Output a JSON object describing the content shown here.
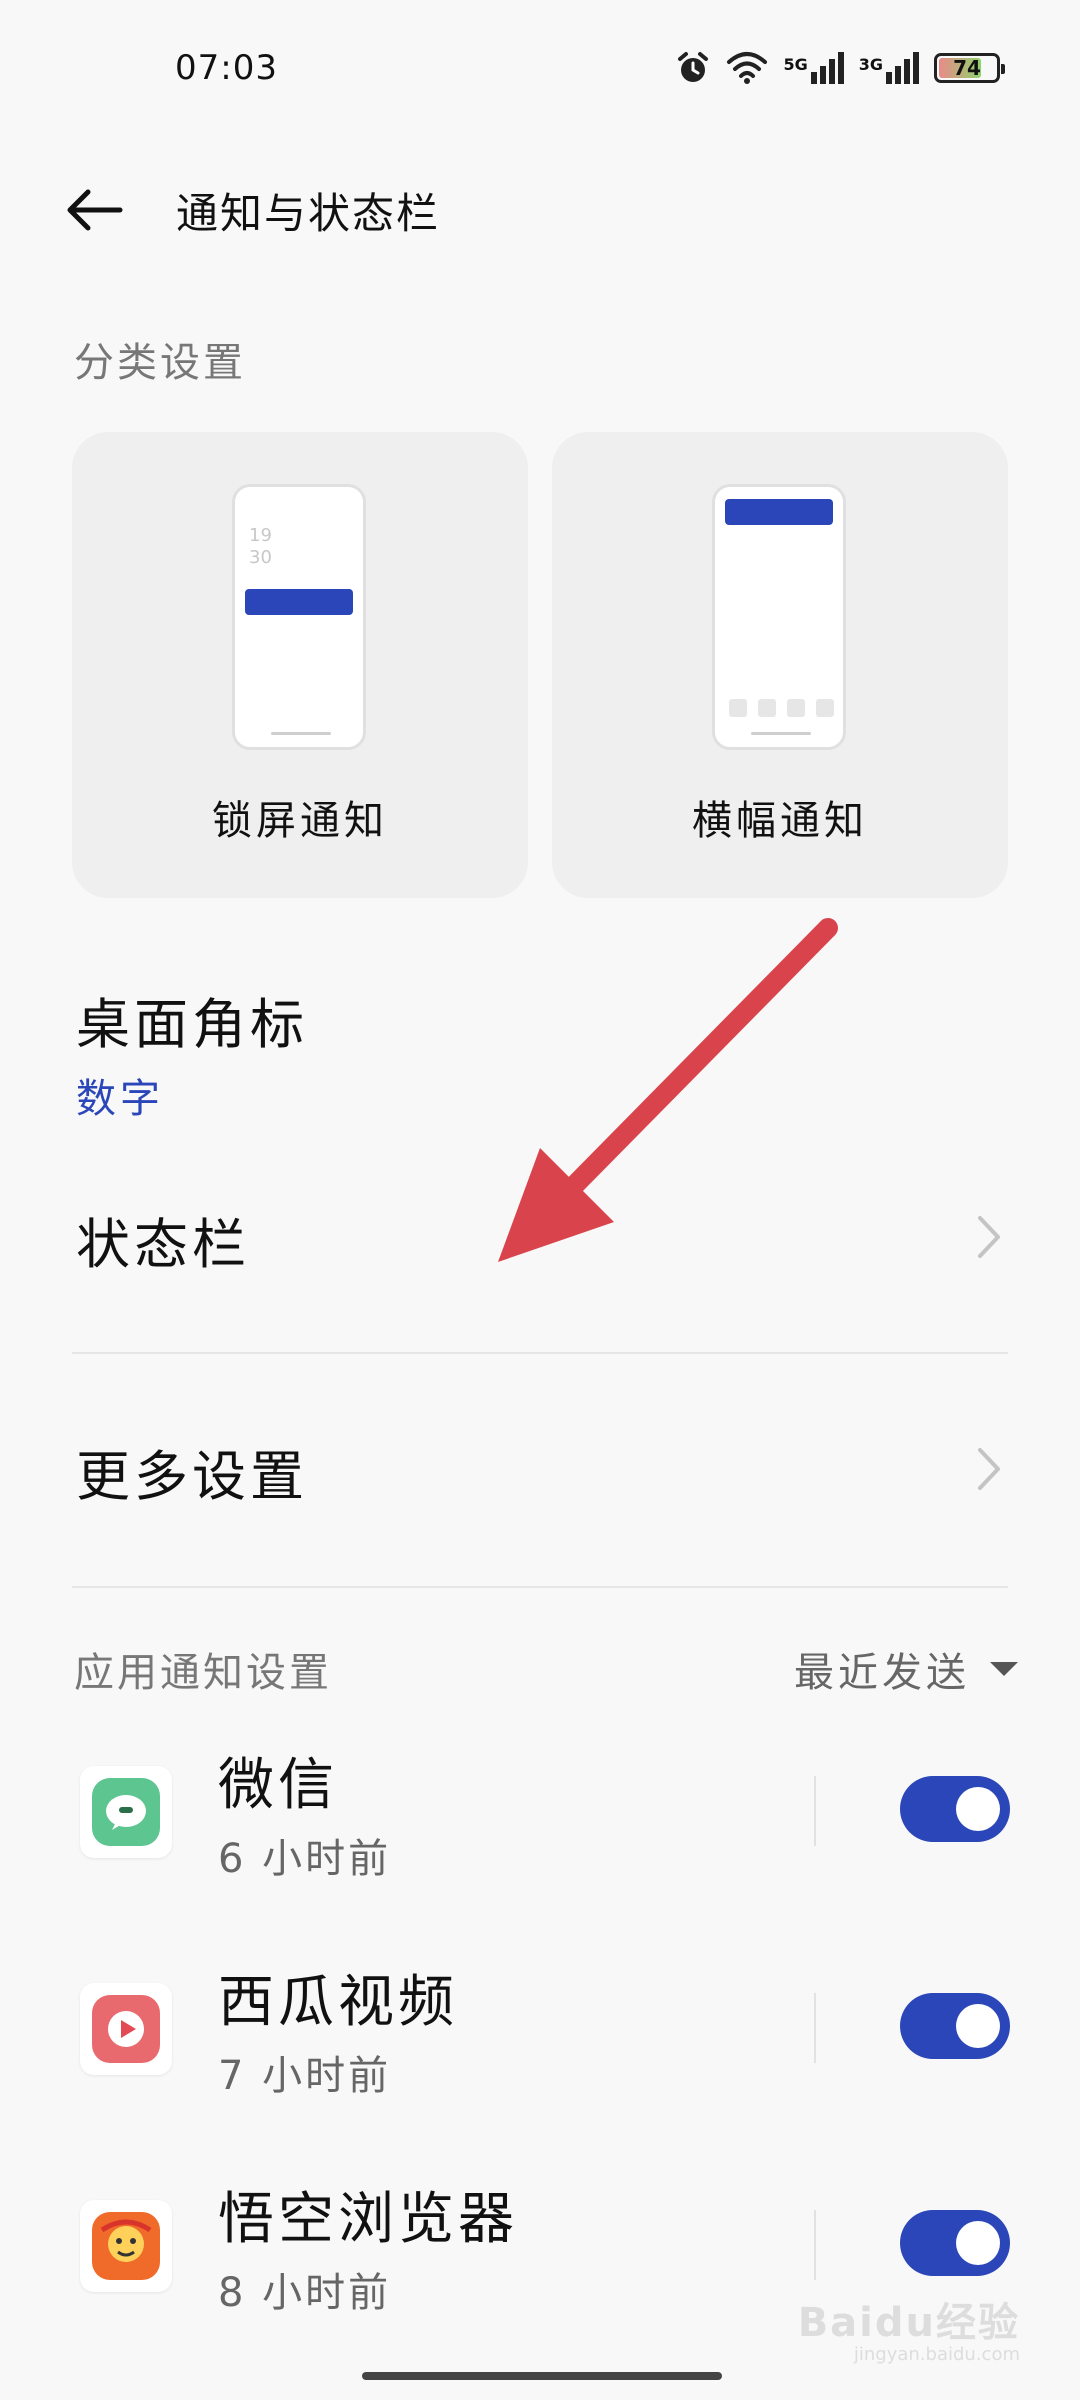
{
  "status_bar": {
    "time": "07:03",
    "battery": "74",
    "net1": "5G",
    "net2": "3G"
  },
  "header": {
    "title": "通知与状态栏"
  },
  "category": {
    "label": "分类设置",
    "cards": [
      {
        "label": "锁屏通知",
        "clock": "19\n30"
      },
      {
        "label": "横幅通知"
      }
    ]
  },
  "badge": {
    "title": "桌面角标",
    "value": "数字"
  },
  "statusbar_item": {
    "title": "状态栏"
  },
  "more": {
    "title": "更多设置"
  },
  "app_notifications": {
    "label": "应用通知设置",
    "sort": "最近发送",
    "apps": [
      {
        "name": "微信",
        "time": "6 小时前",
        "enabled": true
      },
      {
        "name": "西瓜视频",
        "time": "7 小时前",
        "enabled": true
      },
      {
        "name": "悟空浏览器",
        "time": "8 小时前",
        "enabled": true
      }
    ]
  },
  "watermark": {
    "main": "Baidu经验",
    "sub": "jingyan.baidu.com"
  },
  "colors": {
    "accent": "#2b46b8",
    "annotation_arrow": "#d9444c"
  }
}
